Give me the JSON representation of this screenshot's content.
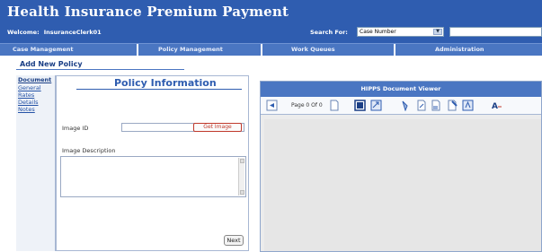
{
  "app": {
    "title": "Health Insurance Premium Payment",
    "welcome_label": "Welcome:",
    "user_name": "InsuranceClerk01",
    "search_label": "Search For:",
    "search_option": "Case Number",
    "search_value": ""
  },
  "menu": {
    "items": [
      {
        "label": "Case Management"
      },
      {
        "label": "Policy Management"
      },
      {
        "label": "Work Queues"
      },
      {
        "label": "Administration"
      }
    ]
  },
  "page": {
    "title": "Add New Policy"
  },
  "left_nav": {
    "items": [
      {
        "label": "Document"
      },
      {
        "label": "General"
      },
      {
        "label": "Rates"
      },
      {
        "label": "Details"
      },
      {
        "label": "Notes"
      }
    ]
  },
  "policy_panel": {
    "heading": "Policy Information",
    "image_id_label": "Image ID",
    "image_id_value": "",
    "get_image_label": "Get Image",
    "image_description_label": "Image Description",
    "image_description_value": "",
    "next_label": "Next"
  },
  "viewer": {
    "title": "HIPPS Document Viewer",
    "page_indicator": "Page 0 Of 0",
    "toolbar_icons": [
      "page-back-icon",
      "page-forward-icon",
      "fit-window-icon",
      "zoom-icon",
      "rotate-left-icon",
      "rotate-right-icon",
      "select-icon",
      "annotate-icon",
      "text-icon"
    ]
  },
  "colors": {
    "header": "#2f5db0",
    "menubar": "#4a76c2",
    "accent_red": "#c0392b",
    "link": "#2452a6"
  }
}
